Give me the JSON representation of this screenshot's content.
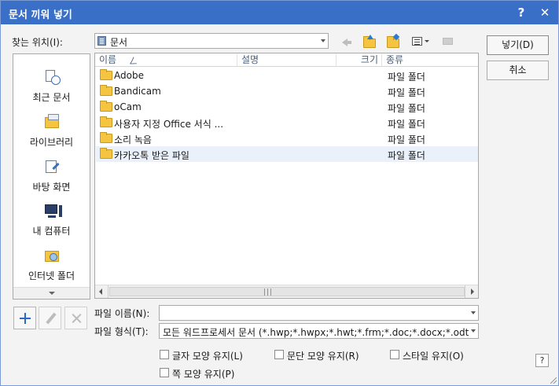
{
  "window": {
    "title": "문서 끼워 넣기",
    "help_glyph": "?",
    "close_glyph": "✕"
  },
  "look_in": {
    "label": "찾는 위치(I):",
    "value": "문서"
  },
  "buttons": {
    "insert": "넣기(D)",
    "cancel": "취소"
  },
  "places": [
    {
      "label": "최근 문서",
      "icon": "recent-documents-icon"
    },
    {
      "label": "라이브러리",
      "icon": "library-icon"
    },
    {
      "label": "바탕 화면",
      "icon": "desktop-icon"
    },
    {
      "label": "내 컴퓨터",
      "icon": "computer-icon"
    },
    {
      "label": "인터넷 폴더",
      "icon": "internet-folder-icon"
    }
  ],
  "columns": {
    "name": "이름",
    "sort_indicator": "ㄥ",
    "desc": "설명",
    "size": "크기",
    "type": "종류"
  },
  "files": [
    {
      "name": "Adobe",
      "type": "파일 폴더"
    },
    {
      "name": "Bandicam",
      "type": "파일 폴더"
    },
    {
      "name": "oCam",
      "type": "파일 폴더"
    },
    {
      "name": "사용자 지정 Office 서식 ...",
      "type": "파일 폴더"
    },
    {
      "name": "소리 녹음",
      "type": "파일 폴더"
    },
    {
      "name": "카카오톡 받은 파일",
      "type": "파일 폴더",
      "selected": true
    }
  ],
  "scrollbar": {
    "grip": "|||"
  },
  "file_name": {
    "label": "파일 이름(N):",
    "value": ""
  },
  "file_type": {
    "label": "파일 형식(T):",
    "value": "모든 워드프로세서 문서 (*.hwp;*.hwpx;*.hwt;*.frm;*.doc;*.docx;*.odt"
  },
  "options": [
    {
      "label": "글자 모양 유지(L)",
      "checked": false
    },
    {
      "label": "문단 모양 유지(R)",
      "checked": false
    },
    {
      "label": "스타일 유지(O)",
      "checked": false
    },
    {
      "label": "쪽 모양 유지(P)",
      "checked": false
    }
  ],
  "help_button": "?",
  "colors": {
    "titlebar": "#3a6fc8",
    "folder": "#f5c542",
    "selection": "#eaf1fb"
  }
}
